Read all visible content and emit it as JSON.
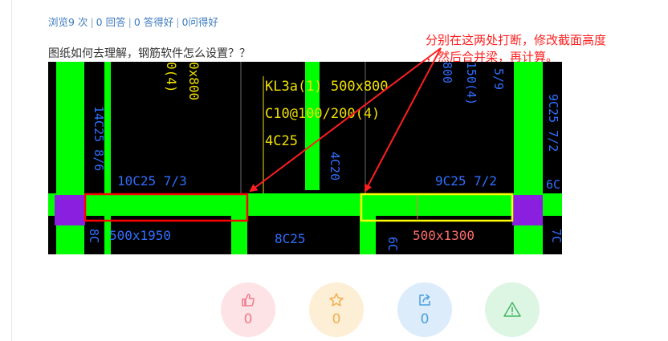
{
  "stats": {
    "views": "浏览9 次",
    "answers": "0 回答",
    "good_answers": "0 答得好",
    "good_questions": "0问得好"
  },
  "question": {
    "title": "图纸如何去理解，钢筋软件怎么设置？？"
  },
  "annotation": {
    "line1": "分别在这两处打断，修改截面高度",
    "line2": "，然后合并梁，再计算。",
    "color": "#ff1f1f"
  },
  "drawing": {
    "labels": {
      "col_left_top": "0(4)",
      "col_left_size": "0x800",
      "beam_name": "KL3a(1) 500x800",
      "stirrup": "C10@100/200(4)",
      "top_bar": "4C25",
      "side_bar_left": "14C25 8/6",
      "side_bar_mid": "4C20",
      "col_right_size": "800",
      "col_right_stirrup": "150(4)",
      "col_right_num": "5/9",
      "far_right_bar": "9C25 7/2",
      "far_right_cut": "6C",
      "bottom_left_bar": "10C25 7/3",
      "bottom_right_bar": "9C25 7/2",
      "size_left": "500x1950",
      "bottom_mid_bar": "8C25",
      "size_right": "500x1300",
      "left_edge_cut": "8C",
      "far_right_bottom_cut": "7C",
      "mid_bottom_cut": "6C"
    },
    "colors": {
      "background": "#000000",
      "member": "#00ff00",
      "column": "#8a1fe0",
      "beam_text": "#f0e000",
      "rebar_text": "#2f6fff",
      "highlight_text": "#ff6a6a",
      "left_outline": "#ff0000",
      "right_outline": "#ffff00"
    }
  },
  "actions": [
    {
      "name": "like",
      "icon": "thumbs-up-icon",
      "count": "0",
      "color": "#f07a8a"
    },
    {
      "name": "favorite",
      "icon": "star-icon",
      "count": "0",
      "color": "#f2ad4c"
    },
    {
      "name": "share",
      "icon": "share-icon",
      "count": "0",
      "color": "#4a9fe0"
    },
    {
      "name": "report",
      "icon": "warning-icon",
      "color": "#44b864"
    }
  ]
}
